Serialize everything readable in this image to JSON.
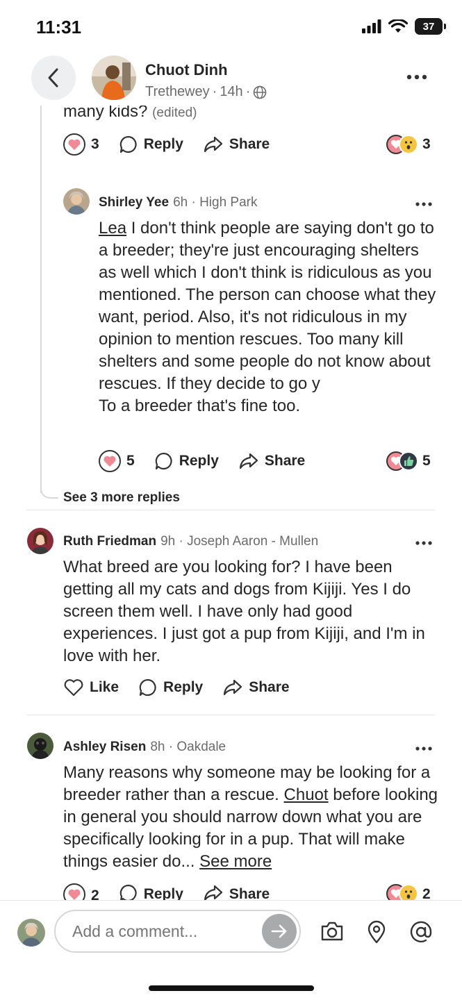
{
  "status_bar": {
    "time": "11:31",
    "battery": "37"
  },
  "header": {
    "author": "Chuot Dinh",
    "neighborhood": "Trethewey",
    "age": "14h"
  },
  "parent_reply": {
    "text_tail": "many kids?",
    "edited": "(edited)",
    "like_count": "3",
    "reply_label": "Reply",
    "share_label": "Share",
    "reaction_count": "3"
  },
  "nested_reply": {
    "author": "Shirley Yee",
    "meta": "6h · High Park",
    "mention": "Lea",
    "text": " I don't think people are saying don't go to a breeder; they're just encouraging shelters as well which I don't think is ridiculous as you mentioned. The person can choose what they want,  period. Also, it's not ridiculous in my opinion to mention rescues. Too many  kill shelters and some people do not know about rescues. If they decide to go y",
    "text_line2": "To a breeder that's fine too.",
    "like_count": "5",
    "reply_label": "Reply",
    "share_label": "Share",
    "reaction_count": "5"
  },
  "see_more_replies": "See 3 more replies",
  "comment1": {
    "author": "Ruth Friedman",
    "meta": "9h · Joseph Aaron - Mullen",
    "text": "What breed are you looking for?   I have been getting all my cats and dogs from Kijiji.   Yes I do screen them well.   I have only had good experiences.   I just got a pup from Kijiji, and I'm in love with her.",
    "like_label": "Like",
    "reply_label": "Reply",
    "share_label": "Share"
  },
  "comment2": {
    "author": "Ashley Risen",
    "meta": "8h · Oakdale",
    "text_a": "Many reasons why someone may be looking for a breeder rather than a rescue. ",
    "mention": "Chuot",
    "text_b": " before looking in general you should narrow down what you are specifically looking for in a pup. That will make things easier do... ",
    "see_more": "See more",
    "like_count": "2",
    "reply_label": "Reply",
    "share_label": "Share",
    "reaction_count": "2"
  },
  "composer": {
    "placeholder": "Add a comment..."
  },
  "colors": {
    "heart": "#f08a94",
    "accent_gray": "#a8aaac",
    "muted": "#6b6b6b"
  }
}
